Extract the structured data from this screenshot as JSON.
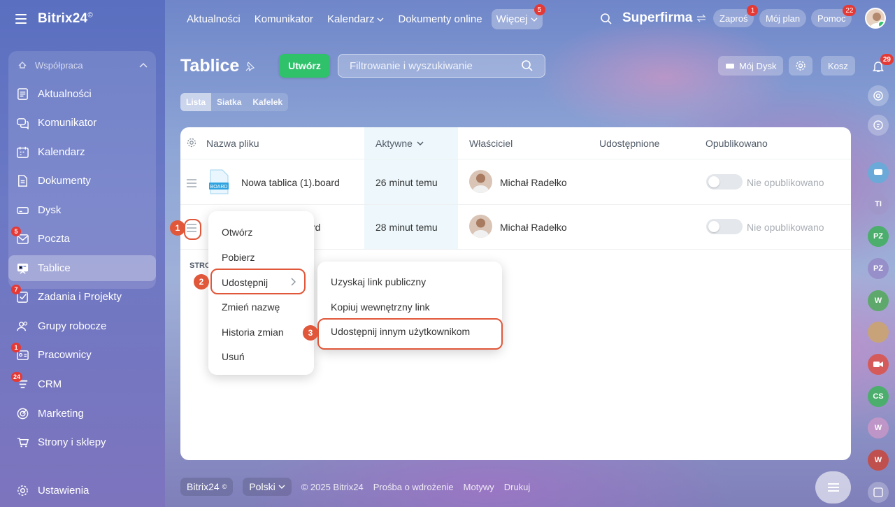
{
  "app": {
    "logo": "Bitrix24",
    "logo_mark": "©"
  },
  "sidebar": {
    "group_label": "Współpraca",
    "items": [
      {
        "label": "Aktualności",
        "icon": "news-icon",
        "badge": ""
      },
      {
        "label": "Komunikator",
        "icon": "chat-icon",
        "badge": ""
      },
      {
        "label": "Kalendarz",
        "icon": "calendar-icon",
        "badge": ""
      },
      {
        "label": "Dokumenty",
        "icon": "document-icon",
        "badge": ""
      },
      {
        "label": "Dysk",
        "icon": "drive-icon",
        "badge": ""
      },
      {
        "label": "Poczta",
        "icon": "mail-icon",
        "badge": "5"
      },
      {
        "label": "Tablice",
        "icon": "board-icon",
        "badge": "",
        "active": true
      },
      {
        "label": "Zadania i Projekty",
        "icon": "tasks-icon",
        "badge": "7"
      },
      {
        "label": "Grupy robocze",
        "icon": "groups-icon",
        "badge": ""
      },
      {
        "label": "Pracownicy",
        "icon": "employees-icon",
        "badge": "1"
      },
      {
        "label": "CRM",
        "icon": "crm-icon",
        "badge": "24"
      },
      {
        "label": "Marketing",
        "icon": "marketing-icon",
        "badge": ""
      },
      {
        "label": "Strony i sklepy",
        "icon": "shop-icon",
        "badge": ""
      }
    ],
    "settings_label": "Ustawienia"
  },
  "topnav": {
    "items": [
      "Aktualności",
      "Komunikator",
      "Kalendarz",
      "Dokumenty online"
    ],
    "more_label": "Więcej",
    "more_badge": "5",
    "company": "Superfirma",
    "invite_label": "Zaproś",
    "invite_badge": "1",
    "plan_label": "Mój plan",
    "help_label": "Pomoc",
    "help_badge": "22"
  },
  "page": {
    "title": "Tablice",
    "create_label": "Utwórz",
    "filter_placeholder": "Filtrowanie i wyszukiwanie",
    "my_drive_label": "Mój Dysk",
    "trash_label": "Kosz",
    "views": [
      "Lista",
      "Siatka",
      "Kafelek"
    ]
  },
  "table": {
    "columns": [
      "Nazwa pliku",
      "Aktywne",
      "Właściciel",
      "Udostępnione",
      "Opublikowano"
    ],
    "rows": [
      {
        "name": "Nowa tablica (1).board",
        "active": "26 minut temu",
        "owner": "Michał Radełko",
        "published": "Nie opublikowano",
        "file_tag": "BOARD"
      },
      {
        "name": "rd",
        "active": "28 minut temu",
        "owner": "Michał Radełko",
        "published": "Nie opublikowano"
      }
    ],
    "footer_label": "STRO"
  },
  "context_menu": {
    "items": [
      "Otwórz",
      "Pobierz",
      "Udostępnij",
      "Zmień nazwę",
      "Historia zmian",
      "Usuń"
    ]
  },
  "submenu": {
    "items": [
      "Uzyskaj link publiczny",
      "Kopiuj wewnętrzny link",
      "Udostępnij innym użytkownikom"
    ]
  },
  "steps": [
    "1",
    "2",
    "3"
  ],
  "notifications_badge": "29",
  "right_rail": {
    "avatars": [
      "TI",
      "PZ",
      "PZ",
      "W",
      "CS",
      "W",
      "W"
    ]
  },
  "footer": {
    "brand": "Bitrix24",
    "language": "Polski",
    "copyright": "© 2025 Bitrix24",
    "links": [
      "Prośba o wdrożenie",
      "Motywy",
      "Drukuj"
    ]
  },
  "colors": {
    "accent_green": "#2fc26b",
    "highlight": "#e0573a",
    "badge_red": "#e53935"
  }
}
